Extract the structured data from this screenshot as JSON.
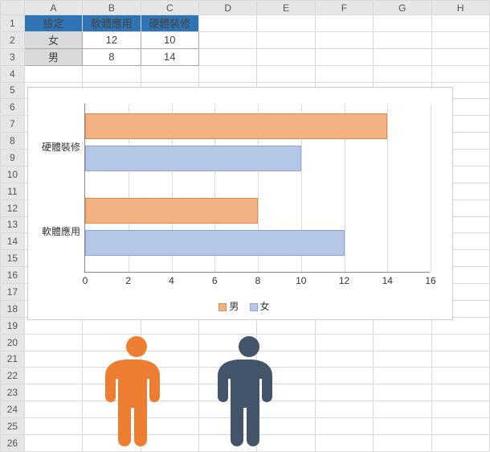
{
  "columns": [
    "A",
    "B",
    "C",
    "D",
    "E",
    "F",
    "G",
    "H"
  ],
  "rows": [
    "1",
    "2",
    "3",
    "4",
    "5",
    "6",
    "7",
    "8",
    "9",
    "10",
    "11",
    "12",
    "13",
    "14",
    "15",
    "16",
    "17",
    "18",
    "19",
    "20",
    "21",
    "22",
    "23",
    "24",
    "25",
    "26"
  ],
  "table": {
    "headers": {
      "a": "檢定",
      "b": "軟體應用",
      "c": "硬體裝修"
    },
    "r2": {
      "a": "女",
      "b": "12",
      "c": "10"
    },
    "r3": {
      "a": "男",
      "b": "8",
      "c": "14"
    }
  },
  "chart_data": {
    "type": "bar",
    "orientation": "horizontal",
    "categories": [
      "硬體裝修",
      "軟體應用"
    ],
    "series": [
      {
        "name": "男",
        "values": [
          14,
          8
        ],
        "color": "#f4b183"
      },
      {
        "name": "女",
        "values": [
          10,
          12
        ],
        "color": "#b4c7e7"
      }
    ],
    "xlabel": "",
    "ylabel": "",
    "xlim": [
      0,
      16
    ],
    "xticks": [
      0,
      2,
      4,
      6,
      8,
      10,
      12,
      14,
      16
    ],
    "legend": [
      "男",
      "女"
    ]
  },
  "icons": {
    "person_left_color": "#ed7d31",
    "person_right_color": "#44546a"
  }
}
